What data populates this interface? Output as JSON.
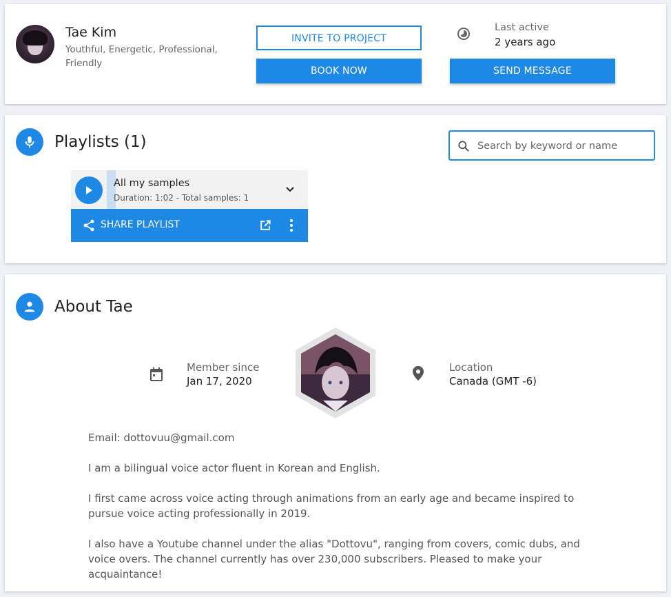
{
  "profile": {
    "name": "Tae Kim",
    "tags": "Youthful, Energetic, Professional, Friendly",
    "invite_label": "INVITE TO PROJECT",
    "book_label": "BOOK NOW",
    "send_label": "SEND MESSAGE",
    "last_active_label": "Last active",
    "last_active_value": "2 years ago"
  },
  "playlists": {
    "title": "Playlists (1)",
    "search_placeholder": "Search by keyword or name",
    "items": [
      {
        "name": "All my samples",
        "meta": "Duration: 1:02 - Total samples: 1",
        "progress": 0.04
      }
    ],
    "share_label": "SHARE PLAYLIST"
  },
  "about": {
    "title": "About Tae",
    "member_since_label": "Member since",
    "member_since_value": "Jan 17, 2020",
    "location_label": "Location",
    "location_value": "Canada (GMT -6)",
    "bio": [
      "Email: dottovuu@gmail.com",
      "I am a bilingual voice actor fluent in Korean and English.",
      "I first came across voice acting through animations from an early age and became inspired to pursue voice acting professionally in 2019.",
      "I also have a Youtube channel under the alias \"Dottovu\", ranging from covers, comic dubs, and voice overs. The channel currently has over 230,000 subscribers. Pleased to make your acquaintance!"
    ]
  },
  "icons": {
    "last_active": "history-icon",
    "playlists": "microphone-icon",
    "search": "search-icon",
    "play": "play-icon",
    "expand": "chevron-down-icon",
    "share": "share-icon",
    "open": "open-in-new-icon",
    "more": "more-vertical-icon",
    "about": "person-icon",
    "member_since": "calendar-icon",
    "location": "location-pin-icon"
  },
  "colors": {
    "accent": "#1e88e5",
    "background": "#eef1f6",
    "card": "#ffffff"
  }
}
